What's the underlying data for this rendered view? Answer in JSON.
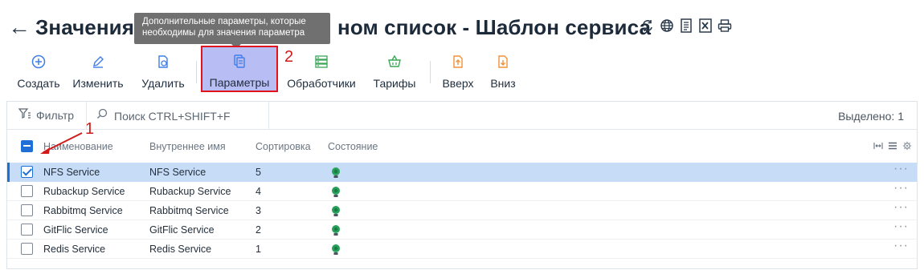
{
  "header": {
    "back_glyph": "←",
    "title_start": "Значения",
    "title_end": "ном список - Шаблон сервиса",
    "action_icons": [
      "refresh-icon",
      "globe-icon",
      "document-list-icon",
      "excel-icon",
      "print-icon"
    ]
  },
  "tooltip": {
    "line1": "Дополнительные параметры, которые",
    "line2": "необходимы для значения параметра"
  },
  "toolbar": {
    "create": "Создать",
    "edit": "Изменить",
    "delete": "Удалить",
    "params": "Параметры",
    "handlers": "Обработчики",
    "tariffs": "Тарифы",
    "up": "Вверх",
    "down": "Вниз"
  },
  "annotations": {
    "num1": "1",
    "num2": "2",
    "color": "#d21a1a"
  },
  "filter_bar": {
    "filter_label": "Фильтр",
    "search_placeholder": "Поиск CTRL+SHIFT+F",
    "selected_count": "Выделено: 1"
  },
  "table": {
    "columns": [
      "Наименование",
      "Внутреннее имя",
      "Сортировка",
      "Состояние"
    ],
    "rows": [
      {
        "name": "NFS Service",
        "internal": "NFS Service",
        "sort": "5",
        "state": "active",
        "selected": true
      },
      {
        "name": "Rubackup Service",
        "internal": "Rubackup Service",
        "sort": "4",
        "state": "active",
        "selected": false
      },
      {
        "name": "Rabbitmq Service",
        "internal": "Rabbitmq Service",
        "sort": "3",
        "state": "active",
        "selected": false
      },
      {
        "name": "GitFlic Service",
        "internal": "GitFlic Service",
        "sort": "2",
        "state": "active",
        "selected": false
      },
      {
        "name": "Redis Service",
        "internal": "Redis Service",
        "sort": "1",
        "state": "active",
        "selected": false
      }
    ],
    "row_menu_glyph": "···"
  },
  "colors": {
    "accent": "#1f6fd6",
    "selected_row": "#c7dcf7",
    "active_button": "#b8bef4",
    "icon_orange": "#f0923a",
    "icon_green": "#3aa757",
    "icon_blue": "#3f7ee8",
    "state_green": "#27a05a"
  }
}
